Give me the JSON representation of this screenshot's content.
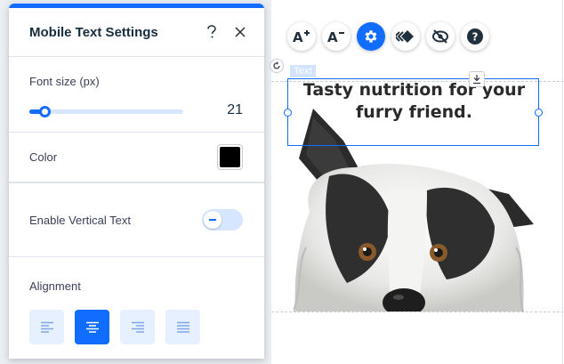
{
  "panel": {
    "title": "Mobile Text Settings",
    "help_icon": "question-mark-icon",
    "close_icon": "close-icon",
    "font_size": {
      "label": "Font size (px)",
      "value": "21",
      "slider_fraction": 0.1
    },
    "color": {
      "label": "Color",
      "value": "#000000"
    },
    "vertical_text": {
      "label": "Enable Vertical Text",
      "enabled": false
    },
    "alignment": {
      "label": "Alignment",
      "options": [
        "left",
        "center",
        "right",
        "justify"
      ],
      "selected": "center"
    }
  },
  "toolbar": {
    "buttons": [
      {
        "name": "increase-font-size",
        "icon": "font-increase-icon"
      },
      {
        "name": "decrease-font-size",
        "icon": "font-decrease-icon"
      },
      {
        "name": "settings",
        "icon": "gear-icon",
        "active": true
      },
      {
        "name": "animation",
        "icon": "animation-icon"
      },
      {
        "name": "hide",
        "icon": "eye-off-icon"
      },
      {
        "name": "help",
        "icon": "help-icon"
      }
    ]
  },
  "component": {
    "tag": "Text",
    "headline": "Tasty nutrition for your furry friend."
  },
  "colors": {
    "accent": "#116dff",
    "accent_light": "#d6e6fe"
  }
}
